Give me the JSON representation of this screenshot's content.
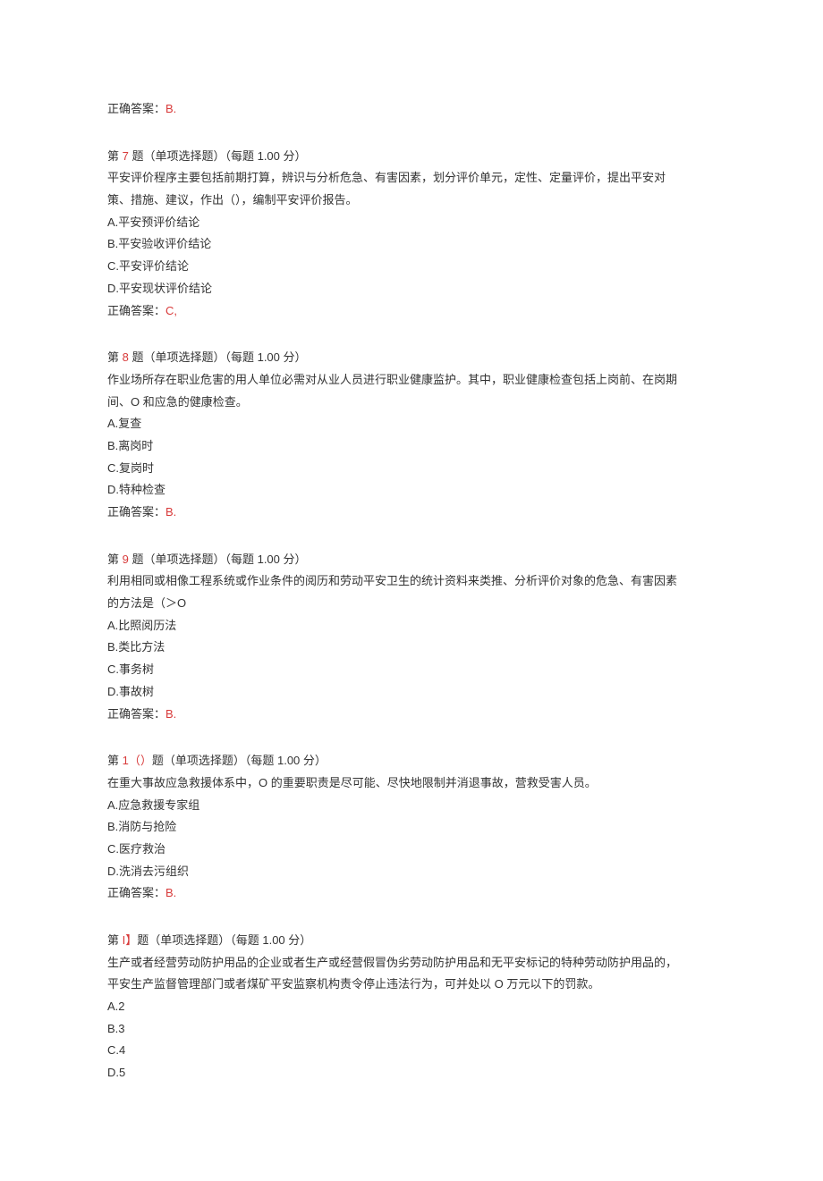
{
  "prev_answer": {
    "label": "正确答案：",
    "value": "B."
  },
  "questions": [
    {
      "num_prefix": "第 ",
      "num": "7",
      "num_suffix": " 题（单项选择题）（每题 1.00 分）",
      "stem_lines": [
        "平安评价程序主要包括前期打算，辨识与分析危急、有害因素，划分评价单元，定性、定量评价，提出平安对",
        "策、措施、建议，作出（），编制平安评价报告。"
      ],
      "options": [
        "A.平安预评价结论",
        "B.平安验收评价结论",
        "C.平安评价结论",
        "D.平安现状评价结论"
      ],
      "answer_label": "正确答案：",
      "answer_value": "C,"
    },
    {
      "num_prefix": "第 ",
      "num": "8",
      "num_suffix": " 题（单项选择题）（每题 1.00 分）",
      "stem_lines": [
        "作业场所存在职业危害的用人单位必需对从业人员进行职业健康监护。其中，职业健康检查包括上岗前、在岗期",
        "间、O 和应急的健康检查。"
      ],
      "options": [
        "A.复查",
        "B.离岗时",
        "C.复岗时",
        "D.特种检查"
      ],
      "answer_label": "正确答案：",
      "answer_value": "B."
    },
    {
      "num_prefix": "第 ",
      "num": "9",
      "num_suffix": " 题（单项选择题）（每题 1.00 分）",
      "stem_lines": [
        "利用相同或相像工程系统或作业条件的阅历和劳动平安卫生的统计资料来类推、分析评价对象的危急、有害因素",
        "的方法是（＞O"
      ],
      "options": [
        "A.比照阅历法",
        "B.类比方法",
        "C.事务树",
        "D.事故树"
      ],
      "answer_label": "正确答案：",
      "answer_value": "B."
    },
    {
      "num_prefix": "第 ",
      "num": "1（）",
      "num_suffix": "题（单项选择题）（每题 1.00 分）",
      "stem_lines": [
        "在重大事故应急救援体系中，O 的重要职责是尽可能、尽快地限制并消退事故，营救受害人员。"
      ],
      "options": [
        "A.应急救援专家组",
        "B.消防与抢险",
        "C.医疗救治",
        "D.洗消去污组织"
      ],
      "answer_label": "正确答案：",
      "answer_value": "B."
    },
    {
      "num_prefix": "第 ",
      "num": "I】",
      "num_suffix": "题（单项选择题）（每题 1.00 分）",
      "stem_lines": [
        "生产或者经营劳动防护用品的企业或者生产或经营假冒伪劣劳动防护用品和无平安标记的特种劳动防护用品的，",
        "平安生产监督管理部门或者煤矿平安监察机构责令停止违法行为，可并处以 O 万元以下的罚款。"
      ],
      "options": [
        "A.2",
        "B.3",
        "C.4",
        "D.5"
      ],
      "answer_label": "",
      "answer_value": ""
    }
  ]
}
